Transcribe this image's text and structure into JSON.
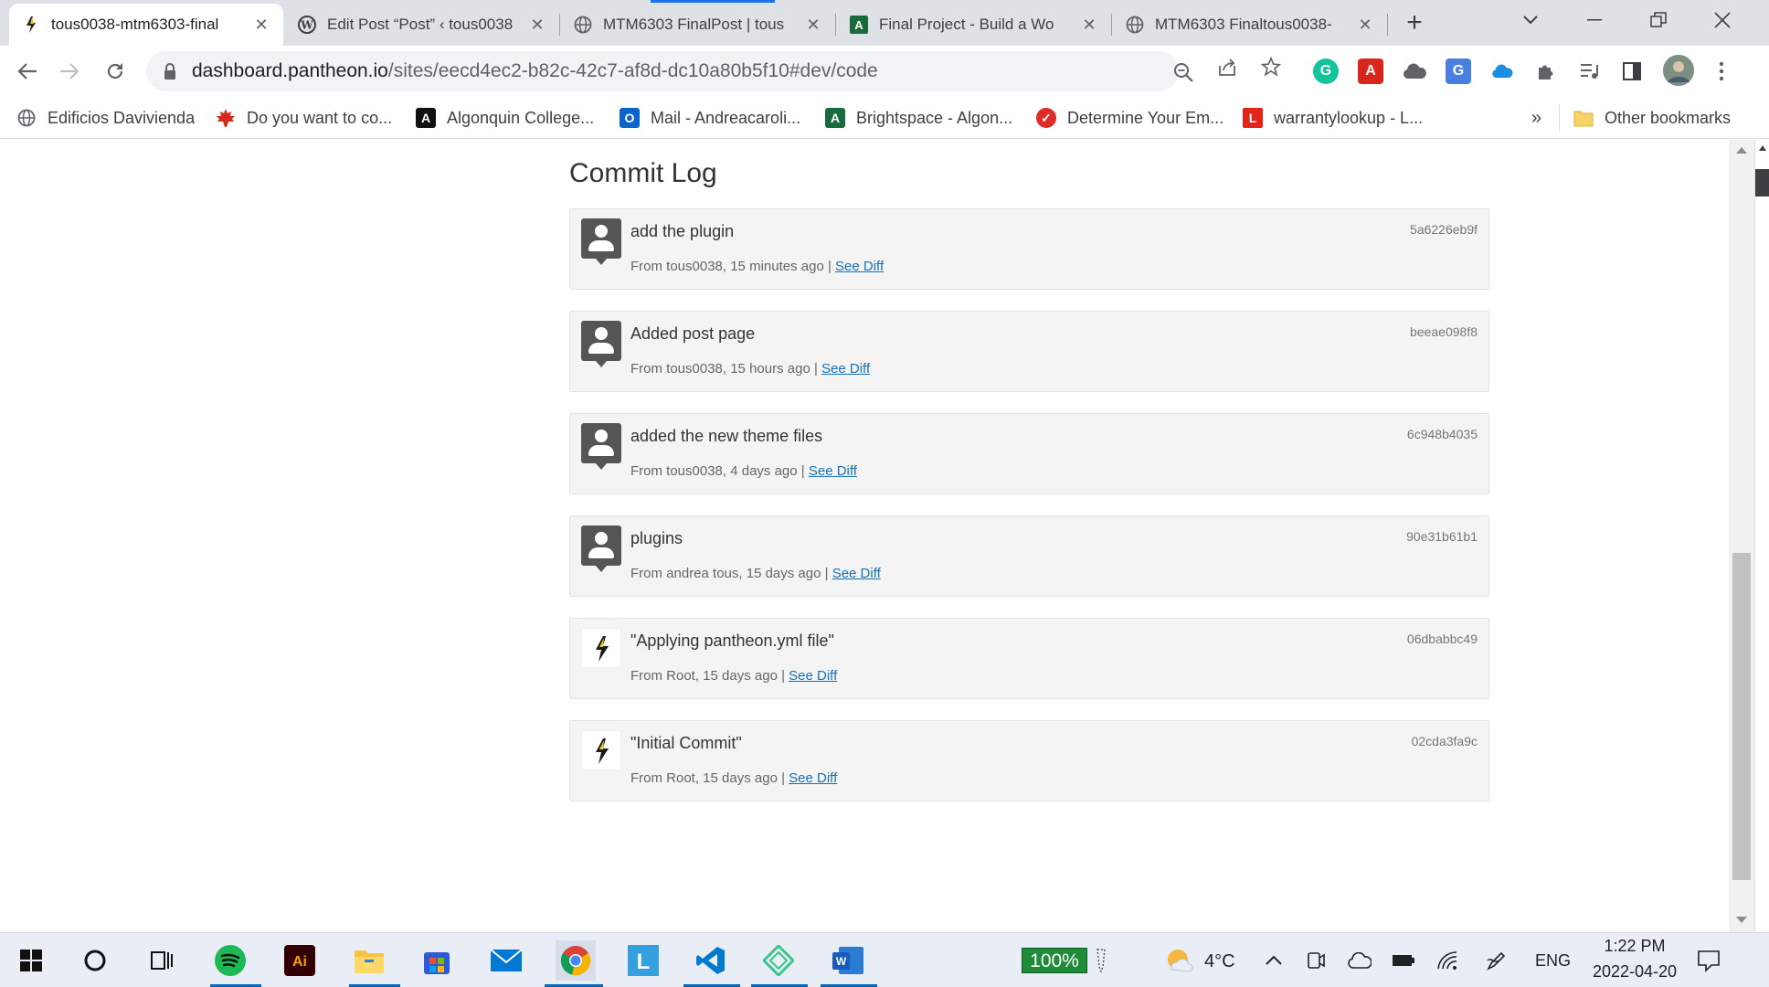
{
  "browser": {
    "tabs": [
      {
        "title": "tous0038-mtm6303-final",
        "active": true
      },
      {
        "title": "Edit Post “Post” ‹ tous0038",
        "active": false
      },
      {
        "title": "MTM6303 FinalPost | tous",
        "active": false
      },
      {
        "title": "Final Project - Build a Wo",
        "active": false
      },
      {
        "title": "MTM6303 Finaltous0038-",
        "active": false
      }
    ],
    "url_host": "dashboard.pantheon.io",
    "url_path": "/sites/eecd4ec2-b82c-42c7-af8d-dc10a80b5f10#dev/code",
    "bookmarks": [
      {
        "label": "Edificios Davivienda",
        "icon": "globe-icon",
        "color": "#5f6368"
      },
      {
        "label": "Do you want to co...",
        "icon": "maple-leaf-icon",
        "color": "#d52b1e"
      },
      {
        "label": "Algonquin College...",
        "icon": "algonquin-icon",
        "color": "#111111"
      },
      {
        "label": "Mail - Andreacaroli...",
        "icon": "outlook-icon",
        "color": "#0a64c9"
      },
      {
        "label": "Brightspace - Algon...",
        "icon": "brightspace-icon",
        "color": "#1a6b3c"
      },
      {
        "label": "Determine Your Em...",
        "icon": "check-circle-icon",
        "color": "#e02c26"
      },
      {
        "label": "warrantylookup - L...",
        "icon": "lenovo-icon",
        "color": "#e2231a"
      }
    ],
    "other_bookmarks": "Other bookmarks",
    "more_bookmarks": "»"
  },
  "page": {
    "heading": "Commit Log",
    "commits": [
      {
        "message": "add the plugin",
        "meta": "From tous0038, 15 minutes ago |",
        "link": "See Diff",
        "hash": "5a6226eb9f",
        "avatar": "user"
      },
      {
        "message": "Added post page",
        "meta": "From tous0038, 15 hours ago |",
        "link": "See Diff",
        "hash": "beeae098f8",
        "avatar": "user"
      },
      {
        "message": "added the new theme files",
        "meta": "From tous0038, 4 days ago |",
        "link": "See Diff",
        "hash": "6c948b4035",
        "avatar": "user"
      },
      {
        "message": "plugins",
        "meta": "From andrea tous, 15 days ago |",
        "link": "See Diff",
        "hash": "90e31b61b1",
        "avatar": "user"
      },
      {
        "message": "\"Applying pantheon.yml file\"",
        "meta": "From Root, 15 days ago |",
        "link": "See Diff",
        "hash": "06dbabbc49",
        "avatar": "root"
      },
      {
        "message": "\"Initial Commit\"",
        "meta": "From Root, 15 days ago |",
        "link": "See Diff",
        "hash": "02cda3fa9c",
        "avatar": "root"
      }
    ]
  },
  "taskbar": {
    "battery": "100%",
    "temperature": "4°C",
    "language": "ENG",
    "time": "1:22 PM",
    "date": "2022-04-20"
  }
}
